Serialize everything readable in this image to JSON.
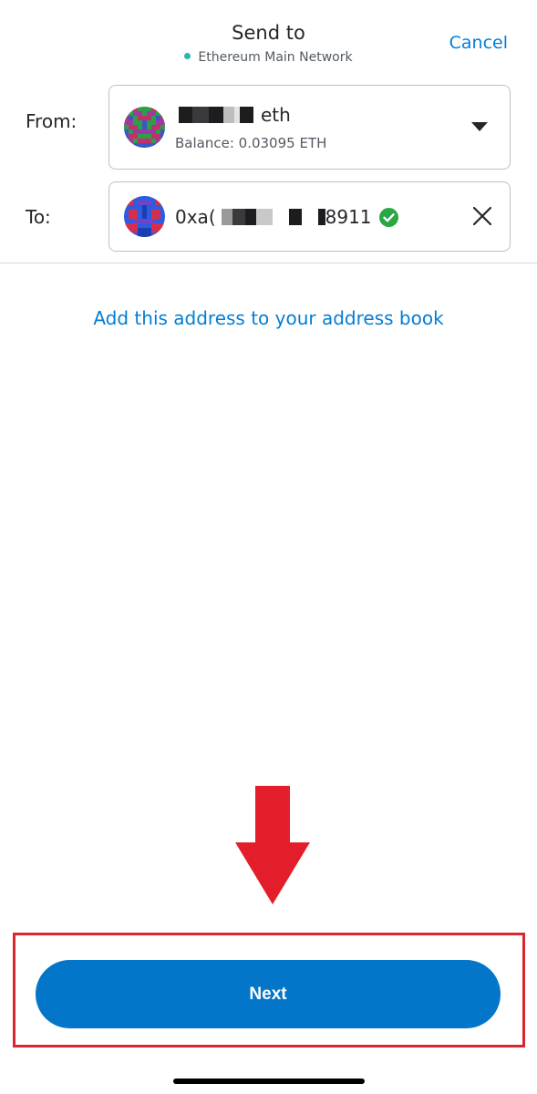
{
  "header": {
    "title": "Send to",
    "network": "Ethereum Main Network",
    "network_dot_color": "#29b6af",
    "cancel_label": "Cancel"
  },
  "from": {
    "label": "From:",
    "account_name_suffix": "eth",
    "balance": "Balance: 0.03095 ETH",
    "avatar_icon": "identicon-icon"
  },
  "to": {
    "label": "To:",
    "address_prefix": "0xa(",
    "address_suffix": "8911",
    "verified_icon": "check-circle-icon",
    "clear_icon": "close-icon"
  },
  "add_address_link": "Add this address to your address book",
  "footer": {
    "next_label": "Next"
  },
  "colors": {
    "accent": "#037dd6",
    "button": "#0376c9",
    "annotation": "#d9262f"
  }
}
